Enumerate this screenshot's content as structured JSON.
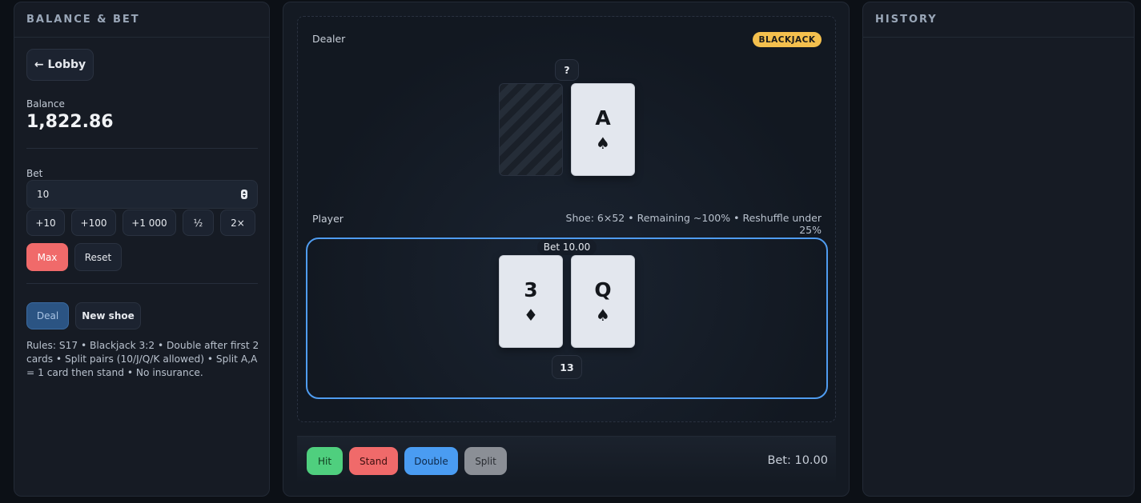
{
  "left_panel": {
    "title": "BALANCE & BET",
    "lobby_label": "← Lobby",
    "balance_label": "Balance",
    "balance_value": "1,822.86",
    "bet_label": "Bet",
    "bet_value": "10",
    "quick_bets": [
      "+10",
      "+100",
      "+1 000",
      "½",
      "2×"
    ],
    "max_label": "Max",
    "reset_label": "Reset",
    "deal_label": "Deal",
    "new_shoe_label": "New shoe",
    "rules_text": "Rules: S17 • Blackjack 3:2 • Double after first 2 cards • Split pairs (10/J/Q/K allowed) • Split A,A = 1 card then stand • No insurance."
  },
  "table": {
    "dealer_label": "Dealer",
    "badge": "BLACKJACK",
    "dealer_total": "?",
    "dealer_cards": [
      {
        "hidden": true
      },
      {
        "rank": "A",
        "suit": "♠"
      }
    ],
    "player_label": "Player",
    "shoe_info": "Shoe: 6×52 • Remaining ~100% • Reshuffle under 25%",
    "bet_tag": "Bet 10.00",
    "player_cards": [
      {
        "rank": "3",
        "suit": "♦"
      },
      {
        "rank": "Q",
        "suit": "♠"
      }
    ],
    "player_total": "13"
  },
  "actions": {
    "hit": "Hit",
    "stand": "Stand",
    "double": "Double",
    "split": "Split",
    "bet_summary": "Bet: 10.00"
  },
  "right_panel": {
    "title": "HISTORY"
  },
  "colors": {
    "accent_blue": "#4f9cf0",
    "hit_green": "#4fcf7e",
    "stand_red": "#f06a6a",
    "badge_gold": "#f4c04e"
  }
}
